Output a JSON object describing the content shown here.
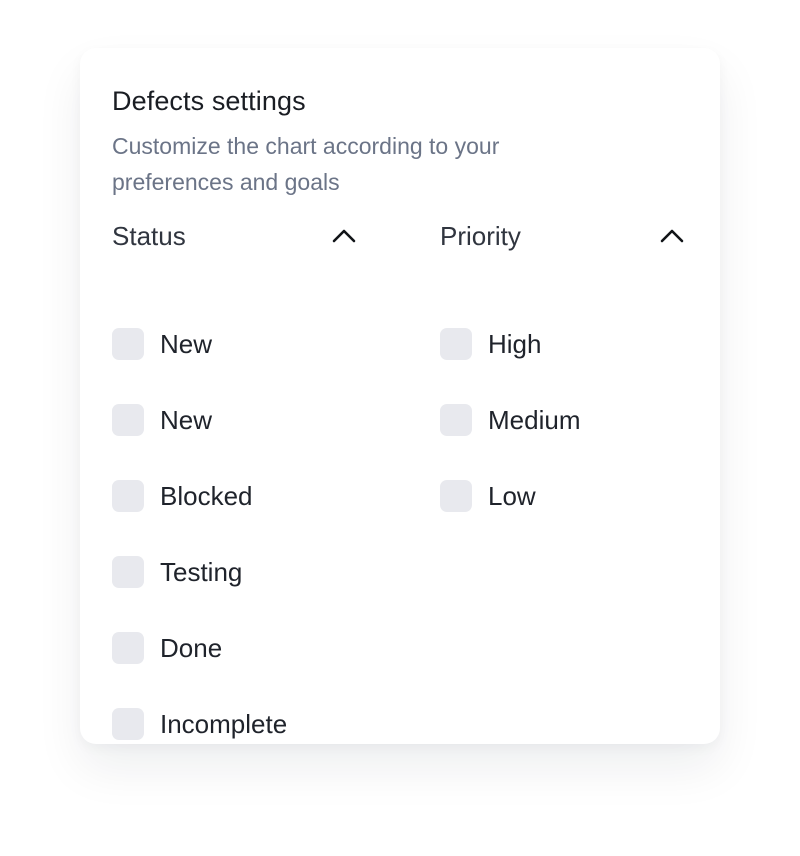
{
  "panel": {
    "title": "Defects settings",
    "subtitle": "Customize the chart according to your preferences and goals"
  },
  "filters": {
    "status": {
      "title": "Status",
      "expanded": true,
      "toggle_icon": "chevron-up-icon",
      "options": [
        {
          "label": "New",
          "checked": false
        },
        {
          "label": "New",
          "checked": false
        },
        {
          "label": "Blocked",
          "checked": false
        },
        {
          "label": "Testing",
          "checked": false
        },
        {
          "label": "Done",
          "checked": false
        },
        {
          "label": "Incomplete",
          "checked": false
        }
      ]
    },
    "priority": {
      "title": "Priority",
      "expanded": true,
      "toggle_icon": "chevron-up-icon",
      "options": [
        {
          "label": "High",
          "checked": false
        },
        {
          "label": "Medium",
          "checked": false
        },
        {
          "label": "Low",
          "checked": false
        }
      ]
    }
  },
  "colors": {
    "checkbox_bg": "#e8e9ee",
    "subtitle_text": "#6b7487",
    "title_text": "#1a1d23"
  }
}
